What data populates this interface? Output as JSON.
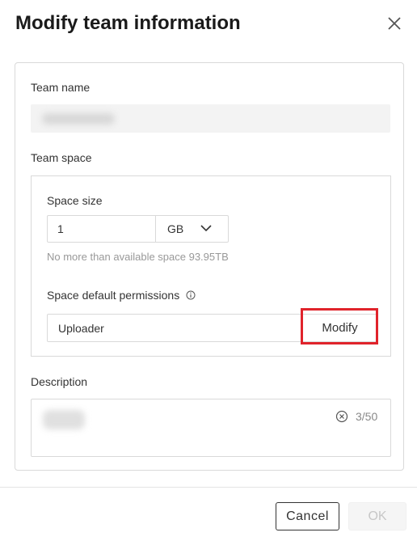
{
  "dialog": {
    "title": "Modify team information",
    "close_icon": "close-icon"
  },
  "team_name": {
    "label": "Team name",
    "value_blurred": true
  },
  "team_space": {
    "label": "Team space",
    "space_size_label": "Space size",
    "size_value": "1",
    "unit_selected": "GB",
    "hint": "No more than available space 93.95TB",
    "permissions_label": "Space default permissions",
    "permissions_value": "Uploader",
    "modify_label": "Modify"
  },
  "description": {
    "label": "Description",
    "counter": "3/50",
    "value_blurred": true
  },
  "footer": {
    "cancel_label": "Cancel",
    "ok_label": "OK"
  },
  "colors": {
    "highlight": "#e0232b",
    "disabled_text": "#c7c7c7",
    "border": "#d9d9d9"
  }
}
